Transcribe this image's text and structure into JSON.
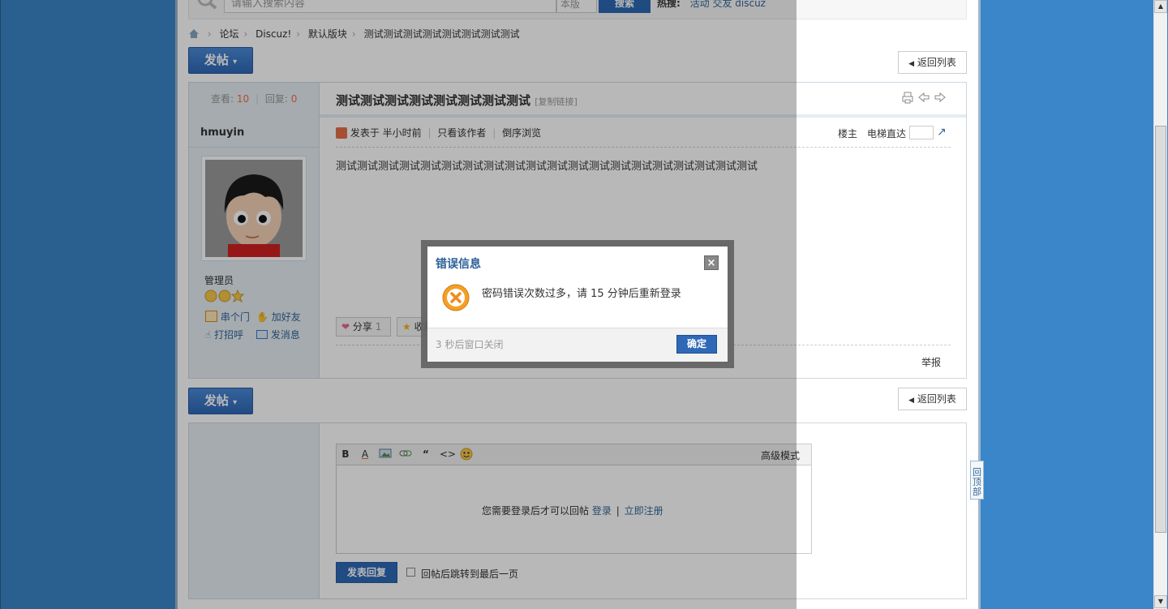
{
  "search": {
    "placeholder": "请输入搜索内容",
    "scope": "本版",
    "button": "搜索",
    "hot_label": "热搜:",
    "hot_terms": "活动 交友 discuz"
  },
  "breadcrumb": [
    "论坛",
    "Discuz!",
    "默认版块",
    "测试测试测试测试测试测试测试测试"
  ],
  "new_thread_label": "发帖",
  "back_to_list": "返回列表",
  "stats": {
    "views_label": "查看:",
    "views": "10",
    "replies_label": "回复:",
    "replies": "0"
  },
  "thread": {
    "title": "测试测试测试测试测试测试测试测试",
    "copy_link": "[复制链接]",
    "content": "测试测试测试测试测试测试测试测试测试测试测试测试测试测试测试测试测试测试测试测试"
  },
  "author": {
    "name": "hmuyin",
    "group": "管理员",
    "visit": "串个门",
    "add_friend": "加好友",
    "greet": "打招呼",
    "message": "发消息"
  },
  "post_meta": {
    "posted": "发表于 半小时前",
    "only_author": "只看该作者",
    "reverse": "倒序浏览",
    "floor": "楼主",
    "jump": "电梯直达"
  },
  "post_actions": {
    "share": "分享",
    "share_count": "1",
    "favorite": "收藏",
    "report": "举报"
  },
  "editor": {
    "advanced": "高级模式",
    "login_notice": "您需要登录后才可以回帖",
    "login": "登录",
    "register": "立即注册",
    "submit": "发表回复",
    "jump_last": "回帖后跳转到最后一页"
  },
  "back_top": "回顶部",
  "dialog": {
    "title": "错误信息",
    "message": "密码错误次数过多，请 15 分钟后重新登录",
    "countdown": "3 秒后窗口关闭",
    "ok": "确定"
  },
  "colors": {
    "accent": "#2f68b6",
    "background": "#3a86c8",
    "error": "#f0a020"
  }
}
